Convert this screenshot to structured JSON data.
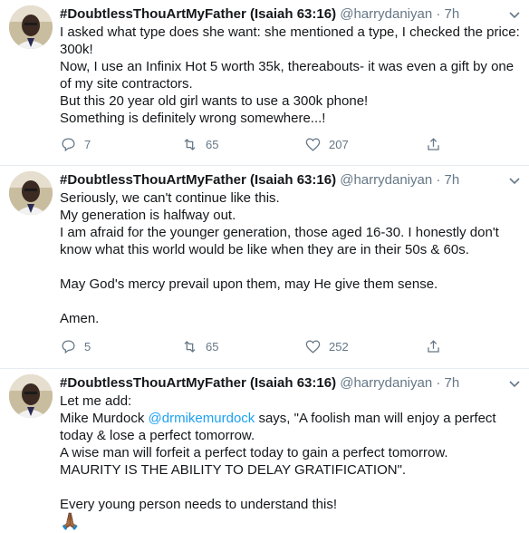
{
  "tweets": [
    {
      "name": "#DoubtlessThouArtMyFather (Isaiah 63:16)",
      "handle": "@harrydaniyan",
      "time": "· 7h",
      "text": "I asked what type does she want: she mentioned a type, I checked the price: 300k!\nNow, I use an Infinix Hot 5 worth 35k, thereabouts- it was even a gift by one of my site contractors.\nBut this 20 year old girl wants to use a 300k phone!\nSomething is definitely wrong somewhere...!",
      "replies": "7",
      "retweets": "65",
      "likes": "207"
    },
    {
      "name": "#DoubtlessThouArtMyFather (Isaiah 63:16)",
      "handle": "@harrydaniyan",
      "time": "· 7h",
      "text": "Seriously, we can't continue like this.\nMy generation is halfway out.\nI am afraid for the younger generation, those aged 16-30. I honestly don't know what this world would be like when they are in their 50s & 60s.\n\nMay God's mercy prevail upon them, may He give them sense.\n\nAmen.",
      "replies": "5",
      "retweets": "65",
      "likes": "252"
    },
    {
      "name": "#DoubtlessThouArtMyFather (Isaiah 63:16)",
      "handle": "@harrydaniyan",
      "time": "· 7h",
      "text_before": "Let me add:\nMike Murdock ",
      "mention": "@drmikemurdock",
      "text_after": " says, \"A foolish man will enjoy a perfect today & lose a perfect tomorrow.\nA wise man will forfeit a perfect today to gain a perfect tomorrow.\nMAURITY IS THE ABILITY TO DELAY GRATIFICATION\".\n\nEvery young person needs to understand this!",
      "emoji": "🙏🏾"
    }
  ],
  "icons": {
    "reply": "reply-icon",
    "retweet": "retweet-icon",
    "like": "heart-icon",
    "share": "share-icon",
    "more": "chevron-down-icon"
  }
}
